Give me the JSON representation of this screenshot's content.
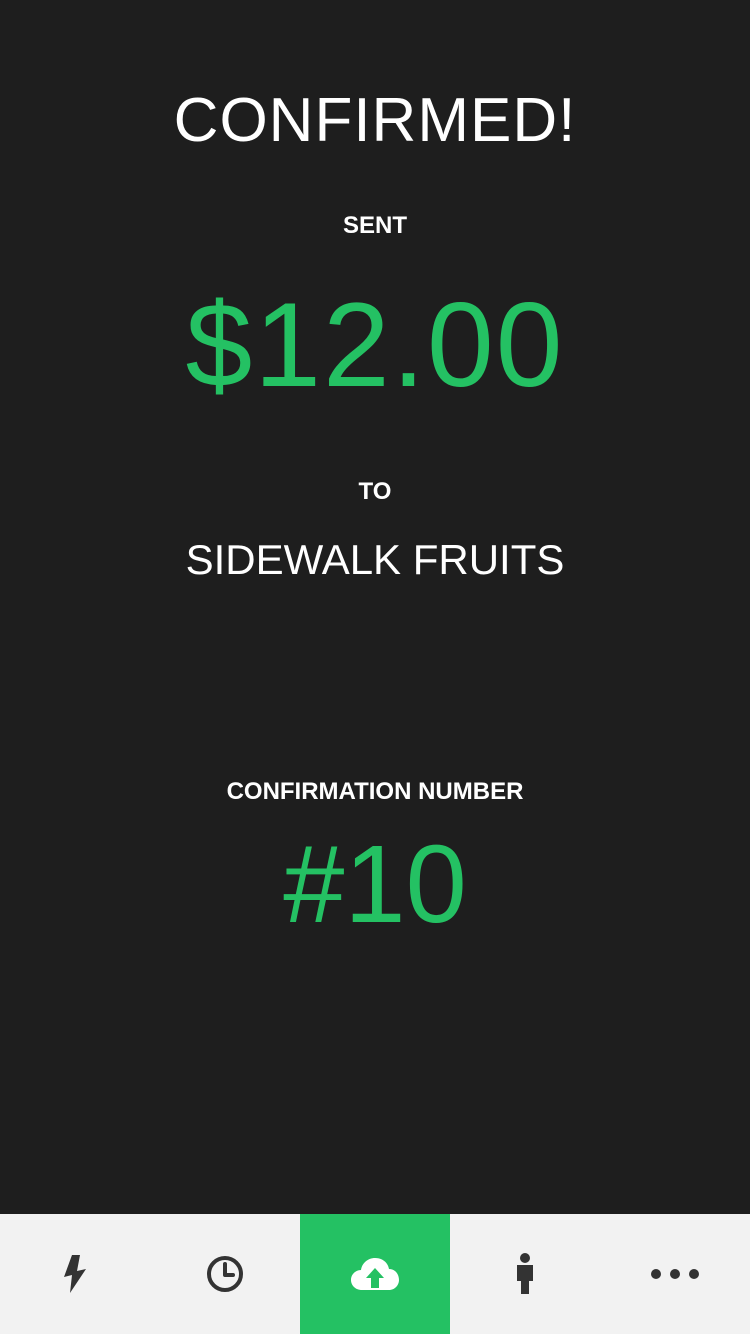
{
  "header": {
    "title": "CONFIRMED!"
  },
  "payment": {
    "sent_label": "SENT",
    "amount": "$12.00",
    "to_label": "TO",
    "recipient": "SIDEWALK FRUITS"
  },
  "confirmation": {
    "label": "CONFIRMATION NUMBER",
    "number": "#10"
  },
  "tabbar": {
    "items": [
      {
        "icon": "lightning-icon",
        "active": false
      },
      {
        "icon": "clock-icon",
        "active": false
      },
      {
        "icon": "cloud-upload-icon",
        "active": true
      },
      {
        "icon": "person-icon",
        "active": false
      },
      {
        "icon": "more-icon",
        "active": false
      }
    ]
  },
  "colors": {
    "background": "#1e1e1e",
    "accent": "#24c163",
    "text": "#ffffff",
    "tabbar_background": "#f2f2f2",
    "icon": "#333333"
  }
}
